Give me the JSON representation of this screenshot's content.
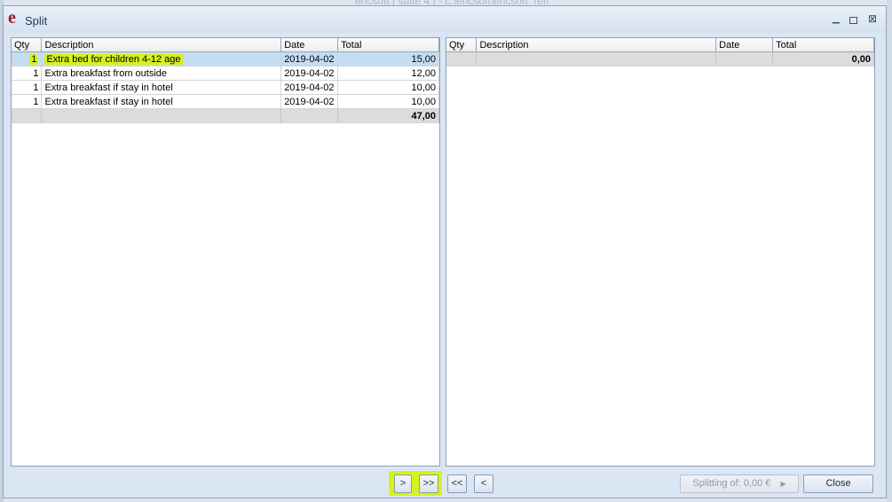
{
  "background": {
    "title": "ericsoft [ suite 4 ] - c:\\ericsoft\\ericsoft_rel\\"
  },
  "dialog": {
    "title": "Split",
    "icon": "e"
  },
  "columns": {
    "qty": "Qty",
    "description": "Description",
    "date": "Date",
    "total": "Total"
  },
  "left_grid": {
    "rows": [
      {
        "qty": "1",
        "description": "Extra bed for children 4-12 age",
        "date": "2019-04-02",
        "total": "15,00",
        "selected": true
      },
      {
        "qty": "1",
        "description": "Extra breakfast from outside",
        "date": "2019-04-02",
        "total": "12,00"
      },
      {
        "qty": "1",
        "description": "Extra breakfast if stay in hotel",
        "date": "2019-04-02",
        "total": "10,00"
      },
      {
        "qty": "1",
        "description": "Extra breakfast if stay in hotel",
        "date": "2019-04-02",
        "total": "10,00"
      }
    ],
    "grand_total": "47,00"
  },
  "right_grid": {
    "rows": [],
    "grand_total": "0,00"
  },
  "buttons": {
    "move_one": ">",
    "move_all": ">>",
    "back_all": "<<",
    "back_one": "<",
    "splitting": "Splitting of: 0,00 €",
    "close": "Close"
  },
  "colors": {
    "highlight": "#d6f21b",
    "selected_row": "#c4ddf3",
    "title_text": "#1e395b"
  }
}
